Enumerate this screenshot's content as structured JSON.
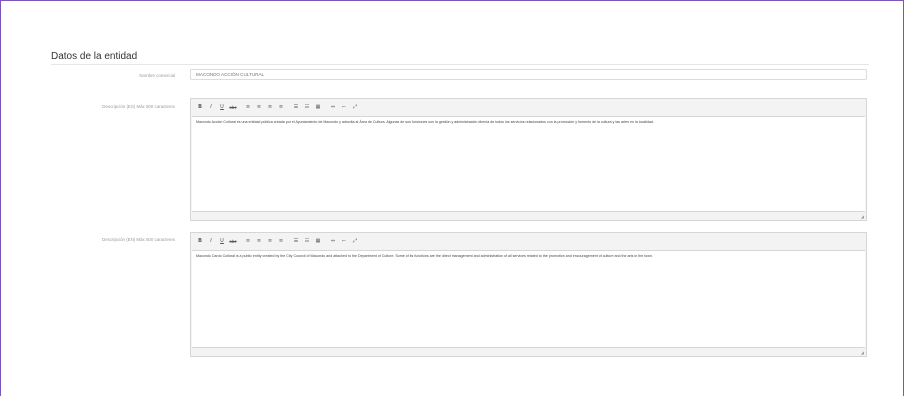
{
  "section": {
    "title": "Datos de la entidad"
  },
  "fields": {
    "nombre": {
      "label": "Nombre comercial",
      "value": "MACONDO ACCIÓN CULTURAL"
    },
    "desc_es": {
      "label": "Descripción (ES) Máx 500 caracteres",
      "text": "Macondo Acción Cultural es una entidad pública creada por el Ayuntamiento de Macondo y adscrita al Área de Cultura. Algunas de sus funciones son la gestión y administración directa de todos los servicios relacionados con la promoción y fomento de la cultura y las artes en la localidad."
    },
    "desc_en": {
      "label": "Descripción (EN) Máx 500 caracteres",
      "text": "Macondo Cardo Cultural is a public entity created by the City Council of Macondo and attached to the Department of Culture. Some of its functions are the direct management and administration of all services related to the promotion and encouragement of culture and the arts in the town."
    }
  },
  "toolbar": {
    "bold": "B",
    "italic": "I",
    "underline": "U",
    "strike": "abc",
    "align_left": "≡",
    "align_center": "≡",
    "align_right": "≡",
    "justify": "≡",
    "bullets": "☰",
    "numbered": "☷",
    "table": "▦",
    "link": "⇔",
    "unlink": "⌐",
    "fullscreen": "⤢"
  },
  "resize_glyph": "◢"
}
